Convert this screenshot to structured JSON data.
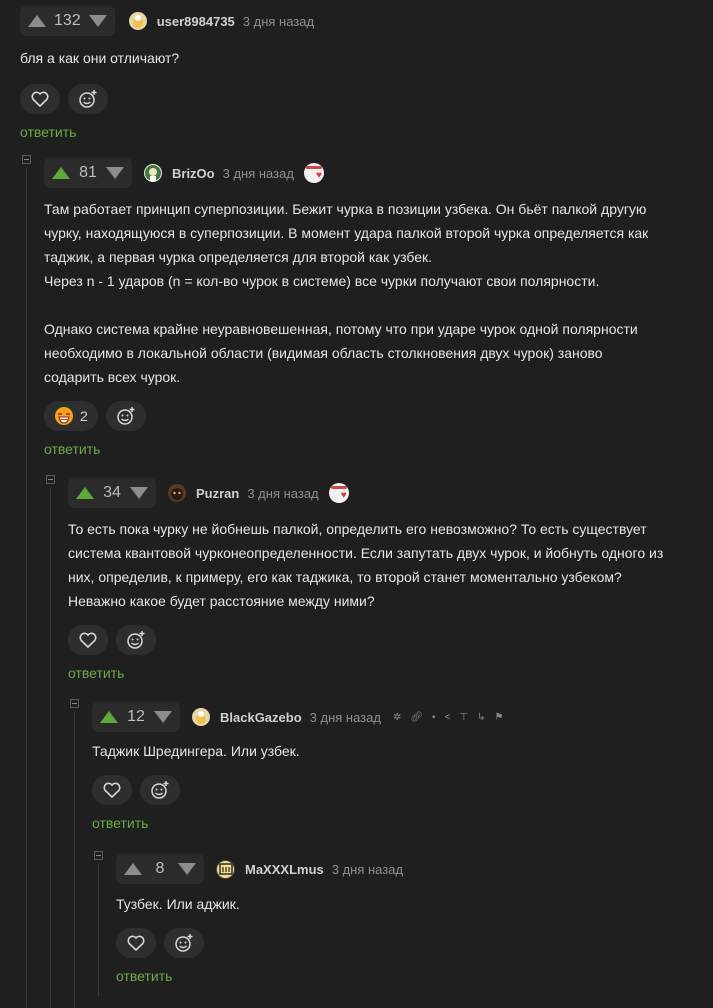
{
  "reply_label": "ответить",
  "colors": {
    "accent_green": "#5fa83a",
    "reply_green": "#6dab45",
    "background": "#1f1f1f"
  },
  "comments": [
    {
      "score": "132",
      "username": "user8984735",
      "time": "3 дня назад",
      "text": "бля а как они отличают?",
      "avatar_icon": "avatar-icon"
    },
    {
      "score": "81",
      "username": "BrizOo",
      "time": "3 дня назад",
      "text": "Там работает принцип суперпозиции. Бежит чурка в позиции узбека. Он бьёт палкой другую чурку, находящуюся в суперпозиции. В момент удара палкой второй чурка определяется как таджик, а первая чурка определяется для второй как узбек.\nЧерез n - 1 ударов (n = кол-во чурок в системе) все чурки получают свои полярности.\n\nОднако система крайне неуравновешенная, потому что при ударе чурок одной полярности необходимо в локальной области (видимая область столкновения двух чурок) заново содарить всех чурок.",
      "reaction_count": "2"
    },
    {
      "score": "34",
      "username": "Puzran",
      "time": "3 дня назад",
      "text": "То есть пока чурку не йобнешь палкой, определить его невозможно? То есть существует система квантовой чурконеопределенности. Если запутать двух чурок, и йобнуть одного из них, определив, к примеру, его как таджика, то второй станет моментально узбеком? Неважно какое будет расстояние между ними?"
    },
    {
      "score": "12",
      "username": "BlackGazebo",
      "time": "3 дня назад",
      "text": "Таджик Шредингера. Или узбек."
    },
    {
      "score": "8",
      "username": "MaXXXLmus",
      "time": "3 дня назад",
      "text": "Тузбек. Или аджик."
    }
  ]
}
